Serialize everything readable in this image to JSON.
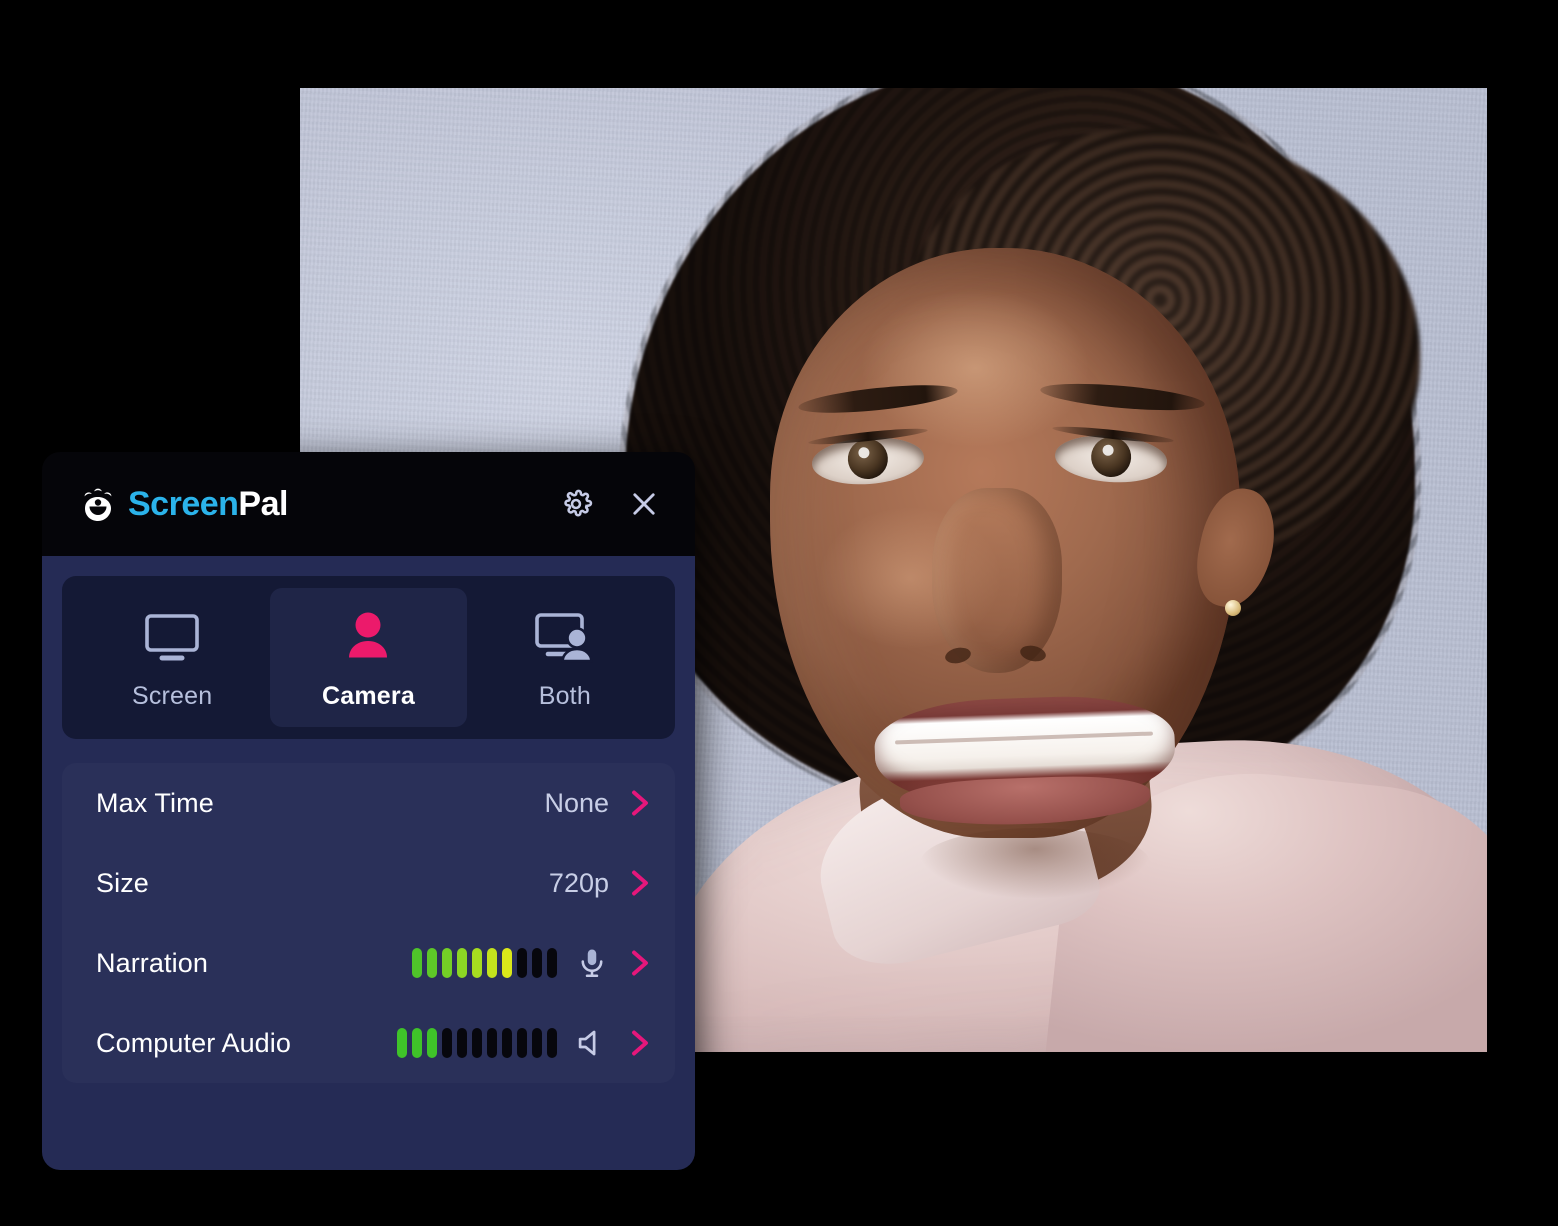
{
  "app": {
    "brand_screen": "Screen",
    "brand_pal": "Pal",
    "accent_pink": "#e5177b",
    "brand_blue": "#2bb3ea",
    "panel_bg": "#252b55",
    "header_bg": "#050509"
  },
  "header": {
    "settings_label": "Settings",
    "close_label": "Close"
  },
  "modes": [
    {
      "id": "screen",
      "label": "Screen",
      "icon": "monitor-icon",
      "selected": false
    },
    {
      "id": "camera",
      "label": "Camera",
      "icon": "person-icon",
      "selected": true
    },
    {
      "id": "both",
      "label": "Both",
      "icon": "monitor-person-icon",
      "selected": false
    }
  ],
  "settings_rows": [
    {
      "id": "max-time",
      "label": "Max Time",
      "value": "None",
      "type": "value"
    },
    {
      "id": "size",
      "label": "Size",
      "value": "720p",
      "type": "value"
    },
    {
      "id": "narration",
      "label": "Narration",
      "type": "meter",
      "icon": "microphone-icon",
      "bars_total": 10,
      "bars_lit": 7,
      "lit_colors": [
        "#4fc42a",
        "#5ec828",
        "#74cf26",
        "#8cd624",
        "#a6dd20",
        "#c3e31d",
        "#dbe81a"
      ],
      "off_color": "#07070d"
    },
    {
      "id": "computer-audio",
      "label": "Computer Audio",
      "type": "meter",
      "icon": "speaker-icon",
      "bars_total": 11,
      "bars_lit": 3,
      "lit_colors": [
        "#3fc329",
        "#3fc329",
        "#3fc329"
      ],
      "off_color": "#07070d"
    }
  ],
  "preview": {
    "description": "Webcam preview of a smiling person with curly hair wearing a light pink collared shirt"
  }
}
